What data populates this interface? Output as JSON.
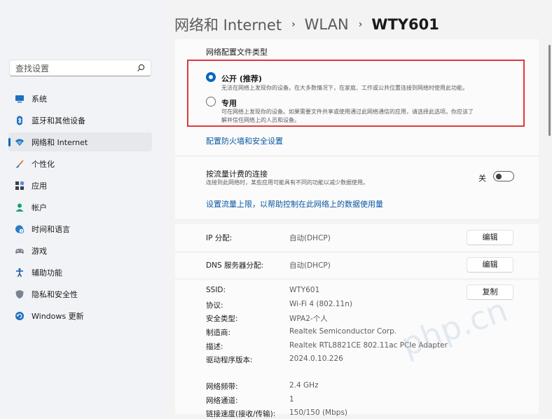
{
  "header": {
    "crumb1": "网络和 Internet",
    "sep1": "›",
    "crumb2": "WLAN",
    "sep2": "›",
    "crumb3": "WTY601"
  },
  "sidebar": {
    "search_placeholder": "查找设置",
    "items": [
      {
        "label": "系统",
        "icon": "monitor-icon"
      },
      {
        "label": "蓝牙和其他设备",
        "icon": "bluetooth-icon"
      },
      {
        "label": "网络和 Internet",
        "icon": "wifi-icon",
        "selected": true
      },
      {
        "label": "个性化",
        "icon": "brush-icon"
      },
      {
        "label": "应用",
        "icon": "apps-icon"
      },
      {
        "label": "帐户",
        "icon": "person-icon"
      },
      {
        "label": "时间和语言",
        "icon": "globe-clock-icon"
      },
      {
        "label": "游戏",
        "icon": "gamepad-icon"
      },
      {
        "label": "辅助功能",
        "icon": "accessibility-icon"
      },
      {
        "label": "隐私和安全性",
        "icon": "shield-icon"
      },
      {
        "label": "Windows 更新",
        "icon": "update-icon"
      }
    ]
  },
  "profile": {
    "heading": "网络配置文件类型",
    "public_label": "公开 (推荐)",
    "public_desc": "无法在网络上发现你的设备。在大多数情况下，在家庭、工作或公共位置连接到网络时使用此功能。",
    "private_label": "专用",
    "private_desc_1": "可在网络上发现你的设备。如果需要文件共享或使用通过此网络通信的应用，请选择此选项。你应该了",
    "private_desc_2": "解并信任网络上的人员和设备。",
    "selected": "public",
    "firewall_link": "配置防火墙和安全设置"
  },
  "metered": {
    "title": "按流量计费的连接",
    "desc": "连接到此网络时，某些应用可能具有不同的功能以减少数据使用。",
    "toggle_label": "关",
    "toggle_on": false,
    "limit_link": "设置流量上限，以帮助控制在此网络上的数据使用量"
  },
  "ip": {
    "label": "IP 分配:",
    "value": "自动(DHCP)",
    "button": "编辑"
  },
  "dns": {
    "label": "DNS 服务器分配:",
    "value": "自动(DHCP)",
    "button": "编辑"
  },
  "props": {
    "copy_button": "复制",
    "rows": [
      {
        "label": "SSID:",
        "value": "WTY601"
      },
      {
        "label": "协议:",
        "value": "Wi-Fi 4 (802.11n)"
      },
      {
        "label": "安全类型:",
        "value": "WPA2-个人"
      },
      {
        "label": "制造商:",
        "value": "Realtek Semiconductor Corp."
      },
      {
        "label": "描述:",
        "value": "Realtek RTL8821CE 802.11ac PCIe Adapter"
      },
      {
        "label": "驱动程序版本:",
        "value": "2024.0.10.226"
      }
    ],
    "rows2": [
      {
        "label": "网络频带:",
        "value": "2.4 GHz"
      },
      {
        "label": "网络通道:",
        "value": "1"
      },
      {
        "label": "链接速度(接收/传输):",
        "value": "150/150 (Mbps)"
      }
    ]
  },
  "watermark": "php.cn",
  "colors": {
    "accent": "#0067c0",
    "highlight_box": "#e0393b",
    "link": "#0a57a3"
  }
}
